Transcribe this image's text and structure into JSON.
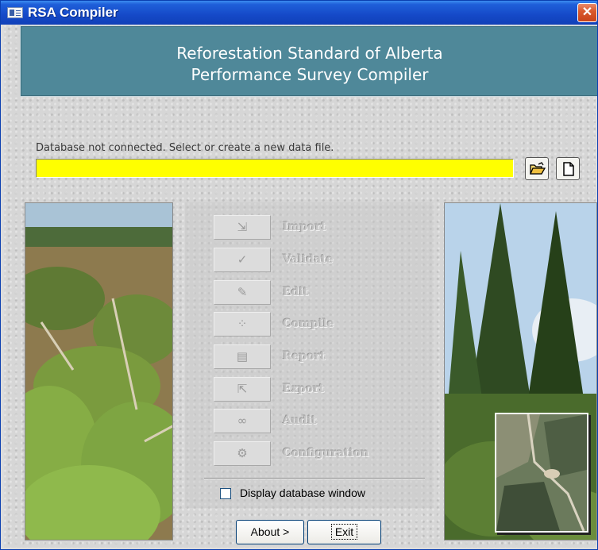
{
  "window": {
    "title": "RSA Compiler",
    "close_glyph": "✕"
  },
  "banner": {
    "line1": "Reforestation Standard of Alberta",
    "line2": "Performance Survey Compiler",
    "color": "#4f8899"
  },
  "database": {
    "status_text": "Database not connected.  Select or create a new data file.",
    "status_value": "",
    "status_color": "#ffff00",
    "open_icon": "open-folder-icon",
    "new_icon": "new-file-icon"
  },
  "menu": {
    "items": [
      {
        "label": "Import",
        "icon": "import-icon",
        "glyph": "⇲"
      },
      {
        "label": "Validate",
        "icon": "validate-icon",
        "glyph": "✓"
      },
      {
        "label": "Edit",
        "icon": "edit-icon",
        "glyph": "✎"
      },
      {
        "label": "Compile",
        "icon": "compile-icon",
        "glyph": "⁘"
      },
      {
        "label": "Report",
        "icon": "report-icon",
        "glyph": "▤"
      },
      {
        "label": "Export",
        "icon": "export-icon",
        "glyph": "⇱"
      },
      {
        "label": "Audit",
        "icon": "binoculars-icon",
        "glyph": "∞"
      },
      {
        "label": "Configuration",
        "icon": "configuration-icon",
        "glyph": "⚙"
      }
    ]
  },
  "options": {
    "display_db_label": "Display database window",
    "display_db_checked": false
  },
  "buttons": {
    "about_label": "About >",
    "exit_label": "Exit"
  }
}
